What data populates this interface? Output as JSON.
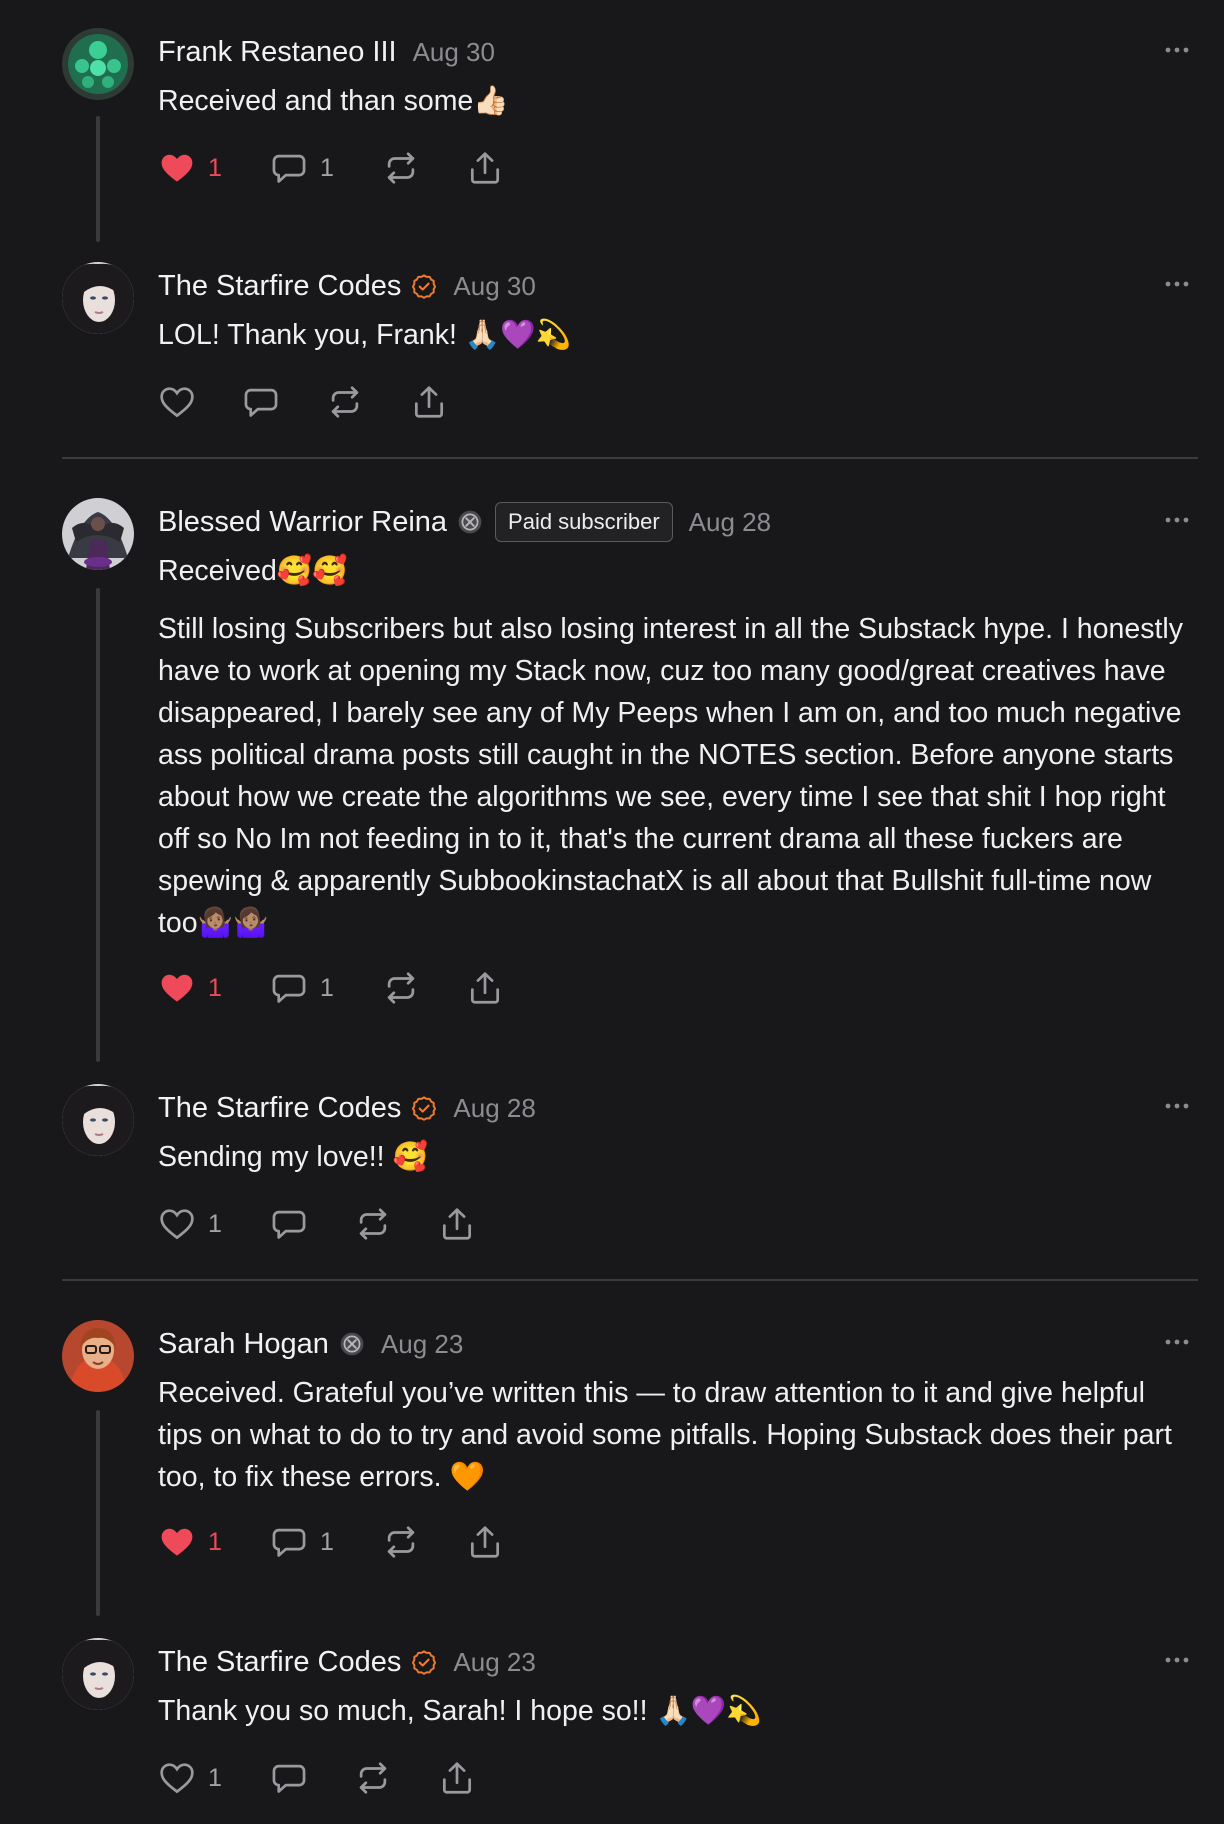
{
  "colors": {
    "background": "#18181b",
    "like_red": "#ef4a5a",
    "verified_orange": "#f07b2f",
    "muted": "#8c8c90"
  },
  "comments": [
    {
      "author": "Frank Restaneo III",
      "date": "Aug 30",
      "text": "Received and than some👍🏻",
      "likes": "1",
      "replies": "1",
      "liked": true
    },
    {
      "author": "The Starfire Codes",
      "verified": true,
      "date": "Aug 30",
      "text": "LOL! Thank you, Frank! 🙏🏻💜💫",
      "likes": "",
      "replies": "",
      "liked": false
    },
    {
      "author": "Blessed Warrior Reina",
      "subscriber_icon": true,
      "badge": "Paid subscriber",
      "date": "Aug 28",
      "text": "Received🥰🥰",
      "text2": "Still losing Subscribers but also losing interest in all the Substack hype. I honestly have to work at opening my Stack now, cuz too many good/great creatives have disappeared, I barely see any of My Peeps when I am on, and too much negative ass political drama posts still caught in the NOTES section. Before anyone starts about how we create the algorithms we see, every time I see that shit I hop right off so No Im not feeding in to it, that's the current drama all these fuckers are spewing & apparently SubbookinstachatX is all about that Bullshit full-time now too🤷🏽‍♀️🤷🏽‍♀️",
      "likes": "1",
      "replies": "1",
      "liked": true
    },
    {
      "author": "The Starfire Codes",
      "verified": true,
      "date": "Aug 28",
      "text": "Sending my love!! 🥰",
      "likes": "1",
      "replies": "",
      "liked": false
    },
    {
      "author": "Sarah Hogan",
      "subscriber_icon": true,
      "date": "Aug 23",
      "text": "Received. Grateful you’ve written this — to draw attention to it and give helpful tips on what to do to try and avoid some pitfalls. Hoping Substack does their part too, to fix these errors. 🧡",
      "likes": "1",
      "replies": "1",
      "liked": true
    },
    {
      "author": "The Starfire Codes",
      "verified": true,
      "date": "Aug 23",
      "text": "Thank you so much, Sarah! I hope so!! 🙏🏻💜💫",
      "likes": "1",
      "replies": "",
      "liked": false
    }
  ]
}
